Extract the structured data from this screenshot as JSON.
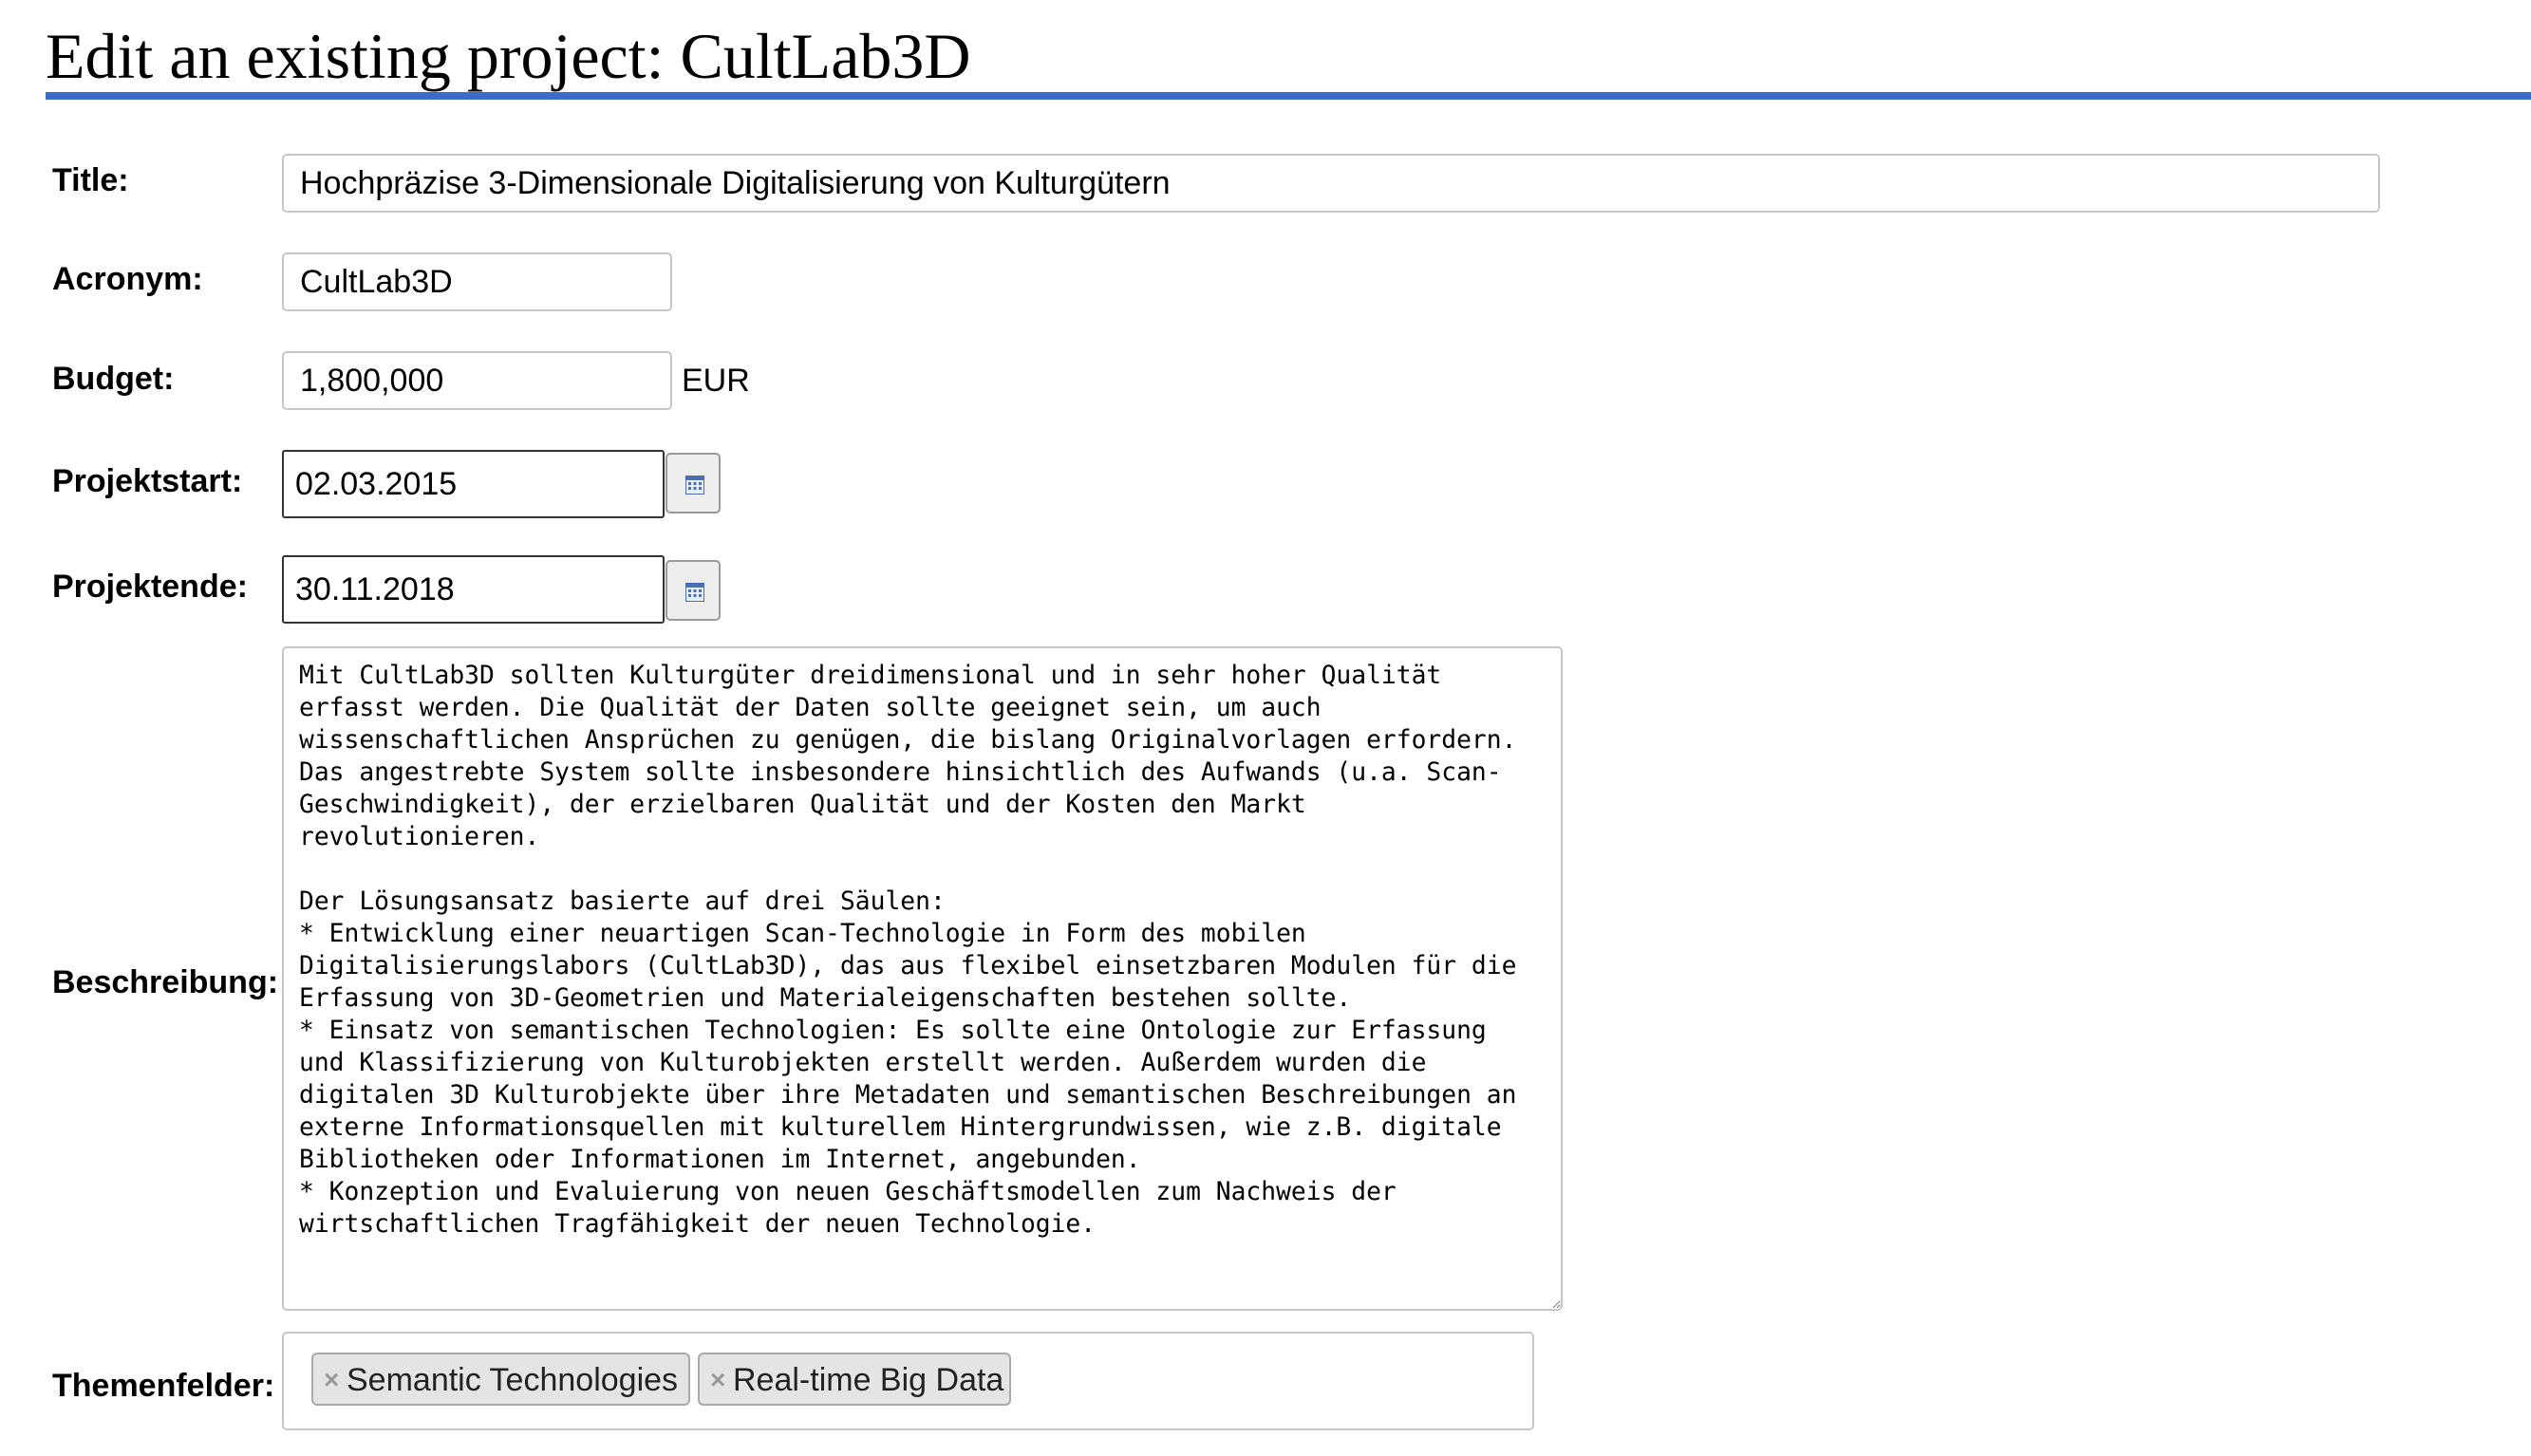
{
  "page": {
    "title": "Edit an existing project: CultLab3D"
  },
  "form": {
    "title_field": {
      "label": "Title:",
      "value": "Hochpräzise 3-Dimensionale Digitalisierung von Kulturgütern"
    },
    "acronym": {
      "label": "Acronym:",
      "value": "CultLab3D"
    },
    "budget": {
      "label": "Budget:",
      "value": "1,800,000",
      "unit": "EUR"
    },
    "start": {
      "label": "Projektstart:",
      "value": "02.03.2015",
      "icon": "calendar-icon"
    },
    "end": {
      "label": "Projektende:",
      "value": "30.11.2018",
      "icon": "calendar-icon"
    },
    "description": {
      "label": "Beschreibung:",
      "value": "Mit CultLab3D sollten Kulturgüter dreidimensional und in sehr hoher Qualität erfasst werden. Die Qualität der Daten sollte geeignet sein, um auch wissenschaftlichen Ansprüchen zu genügen, die bislang Originalvorlagen erfordern. Das angestrebte System sollte insbesondere hinsichtlich des Aufwands (u.a. Scan-Geschwindigkeit), der erzielbaren Qualität und der Kosten den Markt revolutionieren.\n\nDer Lösungsansatz basierte auf drei Säulen:\n* Entwicklung einer neuartigen Scan-Technologie in Form des mobilen Digitalisierungslabors (CultLab3D), das aus flexibel einsetzbaren Modulen für die Erfassung von 3D-Geometrien und Materialeigenschaften bestehen sollte.\n* Einsatz von semantischen Technologien: Es sollte eine Ontologie zur Erfassung und Klassifizierung von Kulturobjekten erstellt werden. Außerdem wurden die digitalen 3D Kulturobjekte über ihre Metadaten und semantischen Beschreibungen an externe Informationsquellen mit kulturellem Hintergrundwissen, wie z.B. digitale Bibliotheken oder Informationen im Internet, angebunden.\n* Konzeption und Evaluierung von neuen Geschäftsmodellen zum Nachweis der wirtschaftlichen Tragfähigkeit der neuen Technologie."
    },
    "topics": {
      "label": "Themenfelder:",
      "remove_symbol": "×",
      "tags": [
        {
          "label": "Semantic Technologies"
        },
        {
          "label": "Real-time Big Data"
        }
      ]
    }
  },
  "colors": {
    "title_rule": "#3d6cc8",
    "tag_background": "#e4e4e4",
    "input_border": "#c7c7c7"
  }
}
